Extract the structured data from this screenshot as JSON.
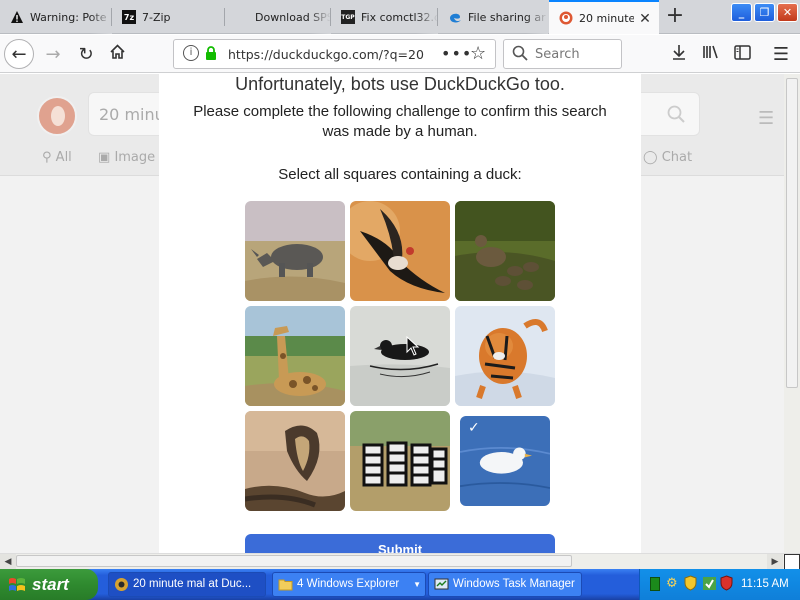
{
  "tabs": [
    {
      "title": "Warning: Pote",
      "icon": "warning-icon"
    },
    {
      "title": "7-Zip",
      "icon": "7zip-icon"
    },
    {
      "title": "Download SPS",
      "icon": "blank-page-icon"
    },
    {
      "title": "Fix comctl32.d",
      "icon": "tgp-icon"
    },
    {
      "title": "File sharing ar",
      "icon": "edge-icon"
    },
    {
      "title": "20 minute",
      "icon": "duckduckgo-icon",
      "active": true
    }
  ],
  "tab_icon_text": {
    "zip": "7z",
    "tgp": "TGP"
  },
  "newtab_label": "+",
  "window_controls": {
    "minimize": "_",
    "restore": "❐",
    "close": "✕"
  },
  "navbar": {
    "url": "https://duckduckgo.com/?q=20",
    "search_placeholder": "Search"
  },
  "ddg_background": {
    "search_value": "20 minut",
    "tabs": {
      "all": "All",
      "images": "Image",
      "chat": "Chat"
    }
  },
  "challenge": {
    "title": "Unfortunately, bots use DuckDuckGo too.",
    "description": "Please complete the following challenge to confirm this search was made by a human.",
    "instruction": "Select all squares containing a duck:",
    "tiles": [
      {
        "subject": "rhinoceros",
        "selected": false
      },
      {
        "subject": "vulture-in-flight",
        "selected": false
      },
      {
        "subject": "ducks-with-ducklings",
        "selected": false
      },
      {
        "subject": "giraffe",
        "selected": false
      },
      {
        "subject": "swimming-duck",
        "selected": false
      },
      {
        "subject": "tiger-in-snow",
        "selected": false
      },
      {
        "subject": "cobra",
        "selected": false
      },
      {
        "subject": "zebras",
        "selected": false
      },
      {
        "subject": "white-duck-swimming",
        "selected": true
      }
    ],
    "check_mark": "✓",
    "submit_label": "Submit"
  },
  "taskbar": {
    "start_label": "start",
    "buttons": [
      {
        "label": "20 minute mal at Duc...",
        "icon": "firefox-icon",
        "active": true
      },
      {
        "label": "4 Windows Explorer",
        "icon": "folder-icon"
      },
      {
        "label": "Windows Task Manager",
        "icon": "task-manager-icon"
      }
    ],
    "clock": "11:15 AM"
  },
  "colors": {
    "accent": "#0a84ff",
    "submit": "#3b6cd8",
    "taskbar": "#245edb",
    "start": "#2f8a2f"
  }
}
